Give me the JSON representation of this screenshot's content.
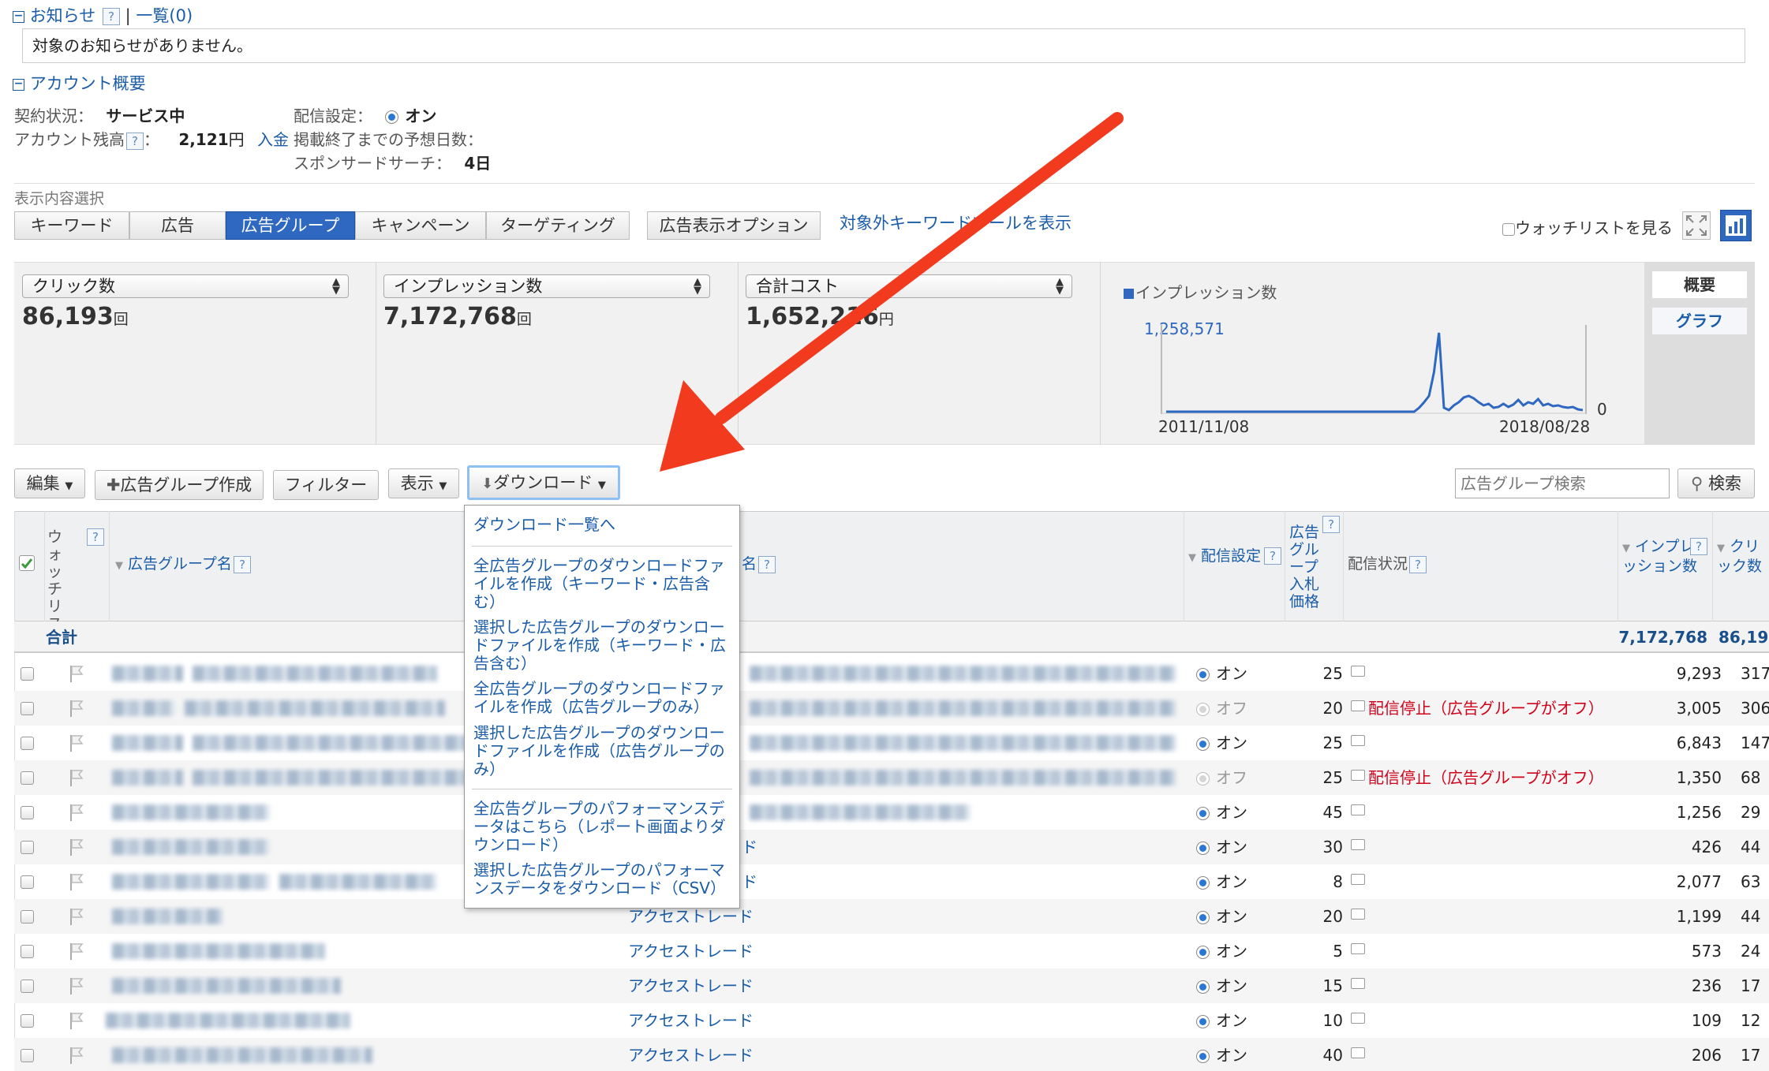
{
  "notice": {
    "toggle": "−",
    "title": "お知らせ",
    "help": "?",
    "separator": "|",
    "list_link": "一覧(0)",
    "message": "対象のお知らせがありません。"
  },
  "account": {
    "toggle": "−",
    "title": "アカウント概要",
    "contract_label": "契約状況：",
    "contract_value": "サービス中",
    "balance_label": "アカウント残高",
    "balance_sep": "：",
    "balance_value": "2,121",
    "balance_unit": "円",
    "deposit_link": "入金",
    "delivery_label": "配信設定：",
    "delivery_value": "オン",
    "days_label": "掲載終了までの予想日数：",
    "sponsored_label": "スポンサードサーチ：",
    "sponsored_value": "4日"
  },
  "view_select": {
    "label": "表示内容選択",
    "tabs": [
      "キーワード",
      "広告",
      "広告グループ",
      "キャンペーン",
      "ターゲティング"
    ],
    "active_tab": "広告グループ",
    "ad_display_option": "広告表示オプション",
    "excluded_keyword_link": "対象外キーワードツールを表示",
    "watchlist_label": "ウォッチリストを見る"
  },
  "summary": {
    "metrics": [
      {
        "select": "クリック数",
        "value": "86,193",
        "unit": "回"
      },
      {
        "select": "インプレッション数",
        "value": "7,172,768",
        "unit": "回"
      },
      {
        "select": "合計コスト",
        "value": "1,652,216",
        "unit": "円"
      }
    ],
    "graph_legend": "インプレッション数",
    "graph_max": "1,258,571",
    "graph_min": "0",
    "date_start": "2011/11/08",
    "date_end": "2018/08/28",
    "side_tabs": [
      "概要",
      "グラフ"
    ]
  },
  "toolbar": {
    "edit": "編集",
    "create": "広告グループ作成",
    "filter": "フィルター",
    "display": "表示",
    "download": "ダウンロード",
    "search_placeholder": "広告グループ検索",
    "search_button": "検索"
  },
  "download_menu": {
    "items": [
      "ダウンロード一覧へ",
      "全広告グループのダウンロードファイルを作成（キーワード・広告含む）",
      "選択した広告グループのダウンロードファイルを作成（キーワード・広告含む）",
      "全広告グループのダウンロードファイルを作成（広告グループのみ）",
      "選択した広告グループのダウンロードファイルを作成（広告グループのみ）",
      "全広告グループのパフォーマンスデータはこちら（レポート画面よりダウンロード）",
      "選択した広告グループのパフォーマンスデータをダウンロード（CSV）"
    ]
  },
  "table": {
    "headers": {
      "watchlist": "ウォッチリスト",
      "name": "広告グループ名",
      "campaign_suffix": "名",
      "delivery": "配信設定",
      "bid": "広告グループ入札価格",
      "status": "配信状況",
      "impressions": "インプレッション数",
      "clicks": "クリック数"
    },
    "total": {
      "label": "合計",
      "impressions": "7,172,768",
      "clicks": "86,19"
    },
    "rows": [
      {
        "campaign": "",
        "delivery": "オン",
        "on": true,
        "bid": "25",
        "status": "",
        "impressions": "9,293",
        "clicks": "317"
      },
      {
        "campaign": "",
        "delivery": "オフ",
        "on": false,
        "bid": "20",
        "status": "配信停止（広告グループがオフ）",
        "impressions": "3,005",
        "clicks": "306"
      },
      {
        "campaign": "",
        "delivery": "オン",
        "on": true,
        "bid": "25",
        "status": "",
        "impressions": "6,843",
        "clicks": "147"
      },
      {
        "campaign": "",
        "delivery": "オフ",
        "on": false,
        "bid": "25",
        "status": "配信停止（広告グループがオフ）",
        "impressions": "1,350",
        "clicks": "68"
      },
      {
        "campaign": "",
        "delivery": "オン",
        "on": true,
        "bid": "45",
        "status": "",
        "impressions": "1,256",
        "clicks": "29"
      },
      {
        "campaign": "ド",
        "delivery": "オン",
        "on": true,
        "bid": "30",
        "status": "",
        "impressions": "426",
        "clicks": "44"
      },
      {
        "campaign": "ド",
        "delivery": "オン",
        "on": true,
        "bid": "8",
        "status": "",
        "impressions": "2,077",
        "clicks": "63"
      },
      {
        "campaign": "アクセストレード",
        "delivery": "オン",
        "on": true,
        "bid": "20",
        "status": "",
        "impressions": "1,199",
        "clicks": "44"
      },
      {
        "campaign": "アクセストレード",
        "delivery": "オン",
        "on": true,
        "bid": "5",
        "status": "",
        "impressions": "573",
        "clicks": "24"
      },
      {
        "campaign": "アクセストレード",
        "delivery": "オン",
        "on": true,
        "bid": "15",
        "status": "",
        "impressions": "236",
        "clicks": "17"
      },
      {
        "campaign": "アクセストレード",
        "delivery": "オン",
        "on": true,
        "bid": "10",
        "status": "",
        "impressions": "109",
        "clicks": "12"
      },
      {
        "campaign": "アクセストレード",
        "delivery": "オン",
        "on": true,
        "bid": "40",
        "status": "",
        "impressions": "206",
        "clicks": "17"
      }
    ]
  },
  "colors": {
    "link": "#1a5ca8",
    "active_tab": "#2e68c0",
    "arrow": "#f23a1e",
    "status_stop": "#d0021b"
  },
  "graph_series": [
    0,
    0,
    0,
    0,
    0,
    0,
    0,
    0,
    0,
    0,
    0,
    0,
    0,
    0,
    0,
    0,
    0,
    0,
    0,
    0,
    0,
    0,
    0,
    0,
    0,
    0,
    0,
    0,
    0,
    0,
    0,
    0,
    0,
    0,
    0,
    0,
    0,
    0,
    0,
    0,
    0,
    0,
    0,
    0,
    0,
    0,
    0,
    0,
    0,
    0,
    0,
    0.05,
    0.12,
    0.2,
    0.5,
    1,
    0.05,
    0.02,
    0.08,
    0.12,
    0.18,
    0.2,
    0.17,
    0.12,
    0.08,
    0.1,
    0.05,
    0.06,
    0.1,
    0.06,
    0.09,
    0.15,
    0.08,
    0.12,
    0.1,
    0.16,
    0.08,
    0.1,
    0.07,
    0.08,
    0.06,
    0.05,
    0.06,
    0.03,
    0.02
  ]
}
